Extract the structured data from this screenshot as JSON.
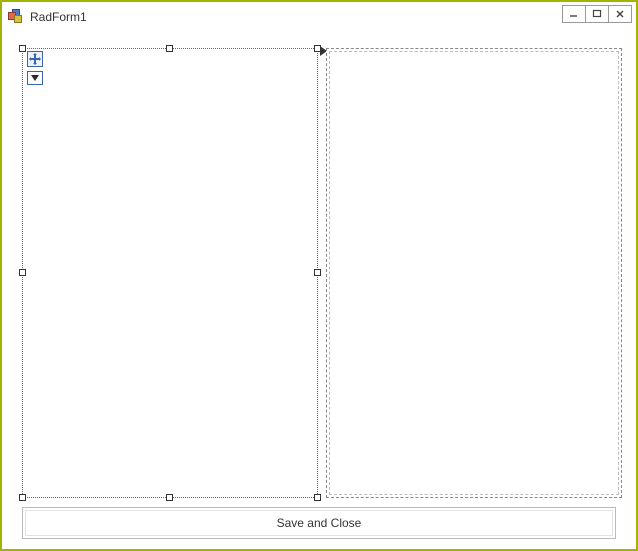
{
  "window": {
    "title": "RadForm1"
  },
  "buttons": {
    "save_close": "Save and  Close"
  }
}
